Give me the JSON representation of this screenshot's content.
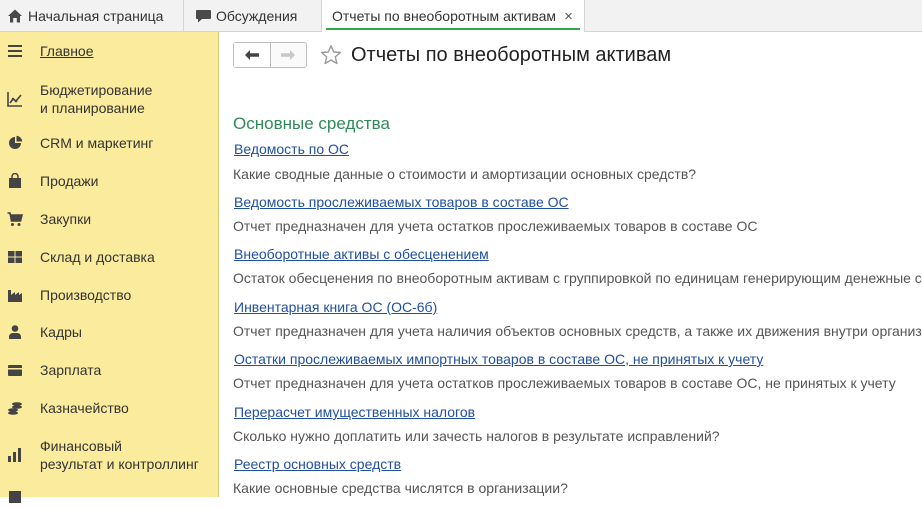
{
  "tabs": {
    "home_label": "Начальная страница",
    "discussions_label": "Обсуждения",
    "active_label": "Отчеты по внеоборотным активам",
    "close_glyph": "×"
  },
  "sidebar": {
    "items": [
      {
        "label": "Главное",
        "icon": "menu-icon"
      },
      {
        "label": "Бюджетирование\nи планирование",
        "icon": "budget-chart-icon"
      },
      {
        "label": "CRM и маркетинг",
        "icon": "pie-chart-icon"
      },
      {
        "label": "Продажи",
        "icon": "shopping-bag-icon"
      },
      {
        "label": "Закупки",
        "icon": "shopping-cart-icon"
      },
      {
        "label": "Склад и доставка",
        "icon": "warehouse-icon"
      },
      {
        "label": "Производство",
        "icon": "factory-icon"
      },
      {
        "label": "Кадры",
        "icon": "person-icon"
      },
      {
        "label": "Зарплата",
        "icon": "wallet-icon"
      },
      {
        "label": "Казначейство",
        "icon": "coins-icon"
      },
      {
        "label": "Финансовый\nрезультат и контроллинг",
        "icon": "finance-chart-icon"
      }
    ]
  },
  "main": {
    "title": "Отчеты по внеоборотным активам",
    "section_title": "Основные средства",
    "reports": [
      {
        "link": "Ведомость по ОС",
        "desc": "Какие сводные данные о стоимости и амортизации основных средств?"
      },
      {
        "link": "Ведомость прослеживаемых товаров в составе ОС",
        "desc": "Отчет предназначен для учета остатков прослеживаемых товаров в составе ОС"
      },
      {
        "link": "Внеоборотные активы с обесценением",
        "desc": "Остаток обесценения по внеоборотным активам с группировкой по единицам генерирующим денежные с"
      },
      {
        "link": "Инвентарная книга ОС (ОС-6б)",
        "desc": "Отчет предназначен для учета наличия объектов основных средств, а также их движения внутри организ"
      },
      {
        "link": "Остатки прослеживаемых импортных товаров в составе ОС, не принятых к учету",
        "desc": "Отчет предназначен для учета остатков прослеживаемых товаров в составе ОС, не принятых к учету"
      },
      {
        "link": "Перерасчет имущественных налогов",
        "desc": "Сколько нужно доплатить или зачесть налогов в результате исправлений?"
      },
      {
        "link": "Реестр основных средств",
        "desc": "Какие основные средства числятся в организации?"
      }
    ]
  },
  "colors": {
    "sidebar_bg": "#fbeb9c",
    "section_green": "#2e8b57",
    "link_blue": "#1f4f9e",
    "active_tab_underline": "#31a74c"
  }
}
